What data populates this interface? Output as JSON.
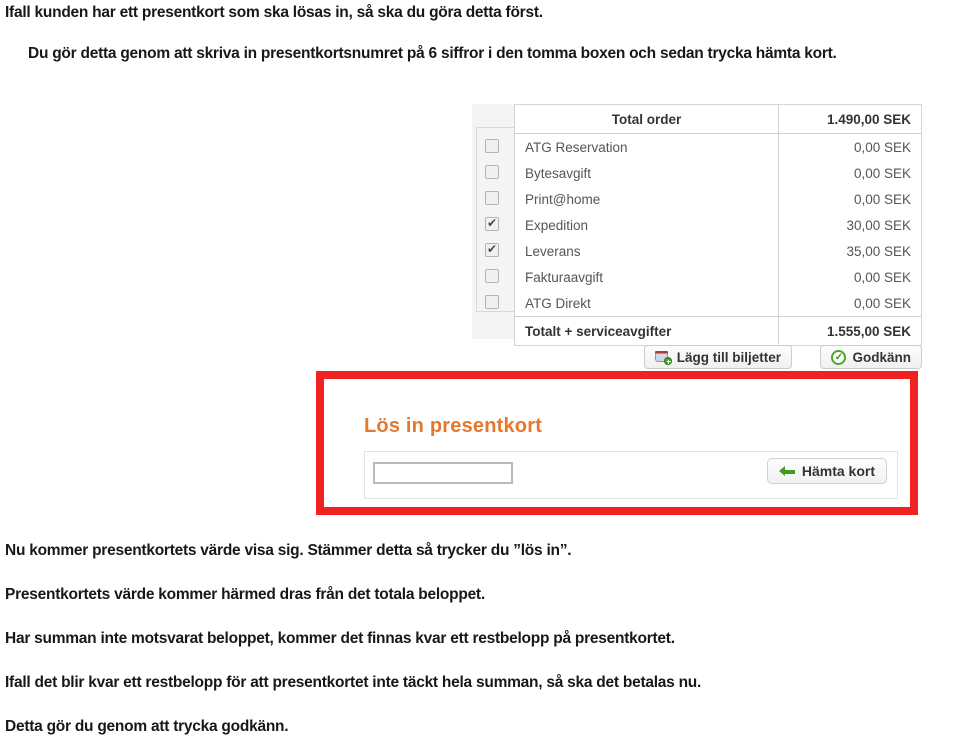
{
  "document": {
    "paragraphs": [
      "Ifall kunden har ett presentkort som ska lösas in, så ska du göra detta först.",
      "Du gör detta genom att skriva in presentkortsnumret på 6 siffror i den tomma boxen och sedan trycka hämta kort.",
      "Nu kommer presentkortets värde visa sig. Stämmer detta så trycker du ”lös in”.",
      "Presentkortets värde kommer härmed dras från det totala beloppet.",
      "Har summan inte motsvarat beloppet, kommer det finnas kvar ett restbelopp på presentkortet.",
      "Ifall det blir kvar ett restbelopp för att presentkortet inte täckt hela summan, så ska det betalas nu.",
      "Detta gör du genom att trycka godkänn."
    ]
  },
  "order_summary": {
    "header": {
      "label": "Total order",
      "amount": "1.490,00 SEK"
    },
    "rows": [
      {
        "label": "ATG Reservation",
        "amount": "0,00 SEK",
        "checked": false
      },
      {
        "label": "Bytesavgift",
        "amount": "0,00 SEK",
        "checked": false
      },
      {
        "label": "Print@home",
        "amount": "0,00 SEK",
        "checked": false
      },
      {
        "label": "Expedition",
        "amount": "30,00 SEK",
        "checked": true
      },
      {
        "label": "Leverans",
        "amount": "35,00 SEK",
        "checked": true
      },
      {
        "label": "Fakturaavgift",
        "amount": "0,00 SEK",
        "checked": false
      },
      {
        "label": "ATG Direkt",
        "amount": "0,00 SEK",
        "checked": false
      }
    ],
    "total": {
      "label": "Totalt + serviceavgifter",
      "amount": "1.555,00 SEK"
    }
  },
  "actions": {
    "add_tickets_label": "Lägg till biljetter",
    "approve_label": "Godkänn"
  },
  "gift_card": {
    "title": "Lös in presentkort",
    "input_value": "",
    "input_placeholder": "",
    "fetch_label": "Hämta kort",
    "highlight_color": "#ee2222",
    "title_color": "#e8762c"
  }
}
